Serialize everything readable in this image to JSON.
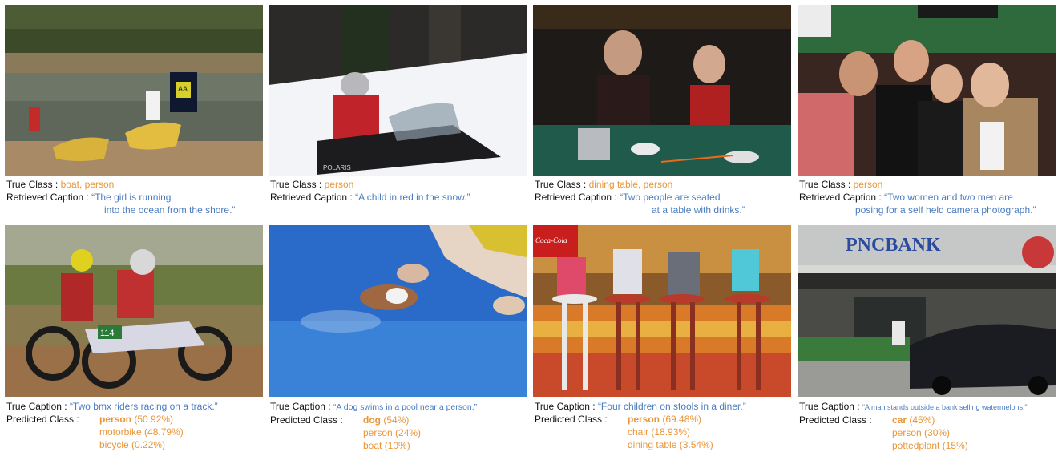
{
  "labels": {
    "true_class": "True Class :",
    "retrieved_caption": "Retrieved Caption :",
    "true_caption": "True Caption :",
    "predicted_class": "Predicted Class :"
  },
  "top_row": [
    {
      "true_class": "boat, person",
      "caption_line1": "“The girl is running",
      "caption_line2": "into the ocean from the shore.”"
    },
    {
      "true_class": "person",
      "caption_line1": "“A child in red in the snow.”",
      "caption_line2": ""
    },
    {
      "true_class": "dining table, person",
      "caption_line1": "“Two people are seated",
      "caption_line2": "at a table with drinks.”"
    },
    {
      "true_class": "person",
      "caption_line1": "“Two women and two men are",
      "caption_line2": "posing for a self held camera photograph.”"
    }
  ],
  "bottom_row": [
    {
      "true_caption": "“Two bmx riders racing on a track.”",
      "predictions": [
        {
          "name": "person",
          "score": "(50.92%)"
        },
        {
          "name": "motorbike",
          "score": "(48.79%)"
        },
        {
          "name": "bicycle",
          "score": "(0.22%)"
        }
      ]
    },
    {
      "true_caption": "“A dog swims in a pool near a person.”",
      "predictions": [
        {
          "name": "dog",
          "score": "(54%)"
        },
        {
          "name": "person",
          "score": "(24%)"
        },
        {
          "name": "boat",
          "score": "(10%)"
        }
      ]
    },
    {
      "true_caption": "“Four children on stools in a diner.”",
      "predictions": [
        {
          "name": "person",
          "score": "(69.48%)"
        },
        {
          "name": "chair",
          "score": "(18.93%)"
        },
        {
          "name": "dining table",
          "score": "(3.54%)"
        }
      ]
    },
    {
      "true_caption": "“A man stands outside a bank selling watermelons.”",
      "predictions": [
        {
          "name": "car",
          "score": "(45%)"
        },
        {
          "name": "person",
          "score": "(30%)"
        },
        {
          "name": "pottedplant",
          "score": "(15%)"
        }
      ]
    }
  ],
  "photo_text": {
    "jersey_logo": "AA",
    "bike_number": "114",
    "snowmobile_brand": "POLARIS",
    "soda_sign": "Coca-Cola",
    "bank_sign": "PNCBANK"
  },
  "colors": {
    "class_text": "#e8963a",
    "caption_text": "#4a7cc0",
    "label_text": "#111111"
  }
}
